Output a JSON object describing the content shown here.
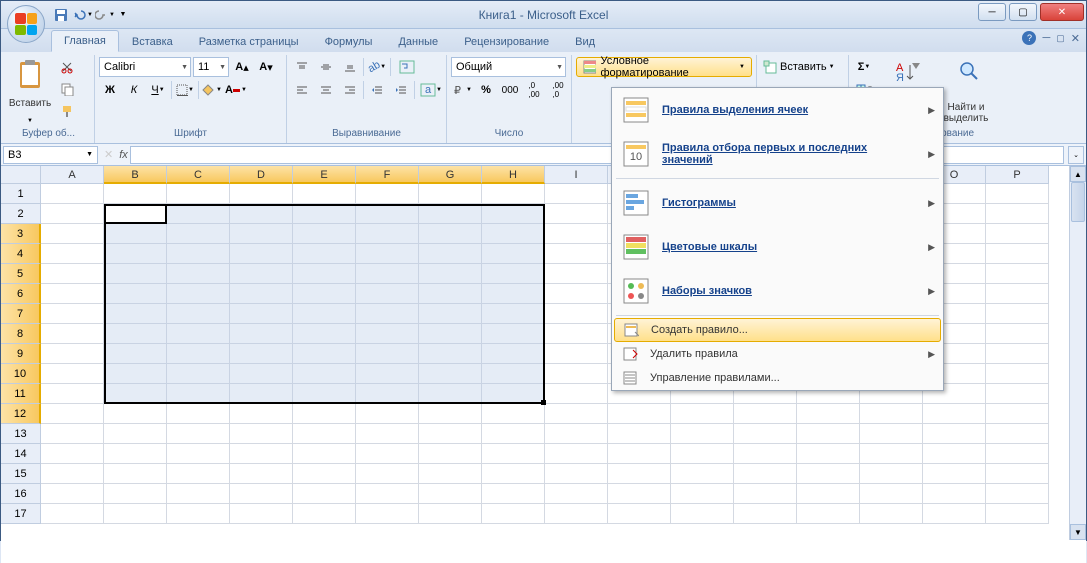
{
  "window": {
    "title": "Книга1 - Microsoft Excel"
  },
  "tabs": {
    "items": [
      "Главная",
      "Вставка",
      "Разметка страницы",
      "Формулы",
      "Данные",
      "Рецензирование",
      "Вид"
    ],
    "active": 0
  },
  "ribbon": {
    "clipboard": {
      "label": "Буфер об...",
      "paste": "Вставить"
    },
    "font": {
      "label": "Шрифт",
      "name": "Calibri",
      "size": "11"
    },
    "alignment": {
      "label": "Выравнивание"
    },
    "number": {
      "label": "Число",
      "format": "Общий"
    },
    "styles": {
      "conditional": "Условное форматирование"
    },
    "cells": {
      "insert": "Вставить"
    },
    "editing": {
      "label": "Редактирование",
      "sort": "ртировка\nи фильтр",
      "find": "Найти и\nвыделить"
    }
  },
  "name_box": "B3",
  "columns": [
    "A",
    "B",
    "C",
    "D",
    "E",
    "F",
    "G",
    "H",
    "I",
    "",
    "",
    "",
    "",
    "",
    "O",
    "P"
  ],
  "selected_cols": [
    1,
    2,
    3,
    4,
    5,
    6,
    7
  ],
  "rows_count": 17,
  "selected_rows": [
    3,
    4,
    5,
    6,
    7,
    8,
    9,
    10,
    11,
    12
  ],
  "cf_menu": {
    "items": [
      {
        "label": "Правила выделения ячеек",
        "sub": true,
        "icon": "highlight"
      },
      {
        "label": "Правила отбора первых и последних значений",
        "sub": true,
        "icon": "top10"
      },
      {
        "label": "Гистограммы",
        "sub": true,
        "icon": "databar"
      },
      {
        "label": "Цветовые шкалы",
        "sub": true,
        "icon": "colorscale"
      },
      {
        "label": "Наборы значков",
        "sub": true,
        "icon": "iconset"
      }
    ],
    "small": [
      {
        "label": "Создать правило...",
        "hover": true,
        "icon": "new"
      },
      {
        "label": "Удалить правила",
        "sub": true,
        "icon": "clear"
      },
      {
        "label": "Управление правилами...",
        "icon": "manage"
      }
    ]
  }
}
